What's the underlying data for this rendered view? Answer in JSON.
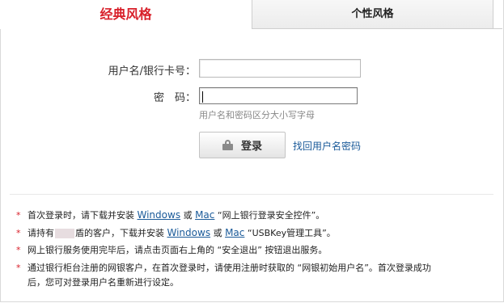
{
  "tabs": {
    "classic": "经典风格",
    "personal": "个性风格"
  },
  "form": {
    "username_label": "用户名/银行卡号：",
    "password_label": "密　码：",
    "username_value": "",
    "password_value": "",
    "case_hint": "用户名和密码区分大小写字母",
    "login_button": "登录",
    "recover_link": "找回用户名密码"
  },
  "notices": {
    "n1": {
      "star": "*",
      "t1": "首次登录时，请下载并安装",
      "windows": "Windows",
      "t2": "或",
      "mac": "Mac",
      "t3": "“网上银行登录安全控件”。"
    },
    "n2": {
      "star": "*",
      "t1": "请持有",
      "t2": "盾的客户，下载并安装",
      "windows": "Windows",
      "t3": "或",
      "mac": "Mac",
      "t4": "“USBKey管理工具”。"
    },
    "n3": {
      "star": "*",
      "t1": "网上银行服务使用完毕后，请点击页面右上角的 “安全退出” 按钮退出服务。"
    },
    "n4": {
      "star": "*",
      "t1": "通过银行柜台注册的网银客户，在首次登录时，请使用注册时获取的 “网银初始用户名”。首次登录成功",
      "t2": "后，您可对登录用户名重新进行设定。"
    }
  },
  "colors": {
    "accent_red": "#d8202a",
    "link_blue": "#1a5a99"
  },
  "icons": {
    "login_button_icon": "lock-icon"
  }
}
